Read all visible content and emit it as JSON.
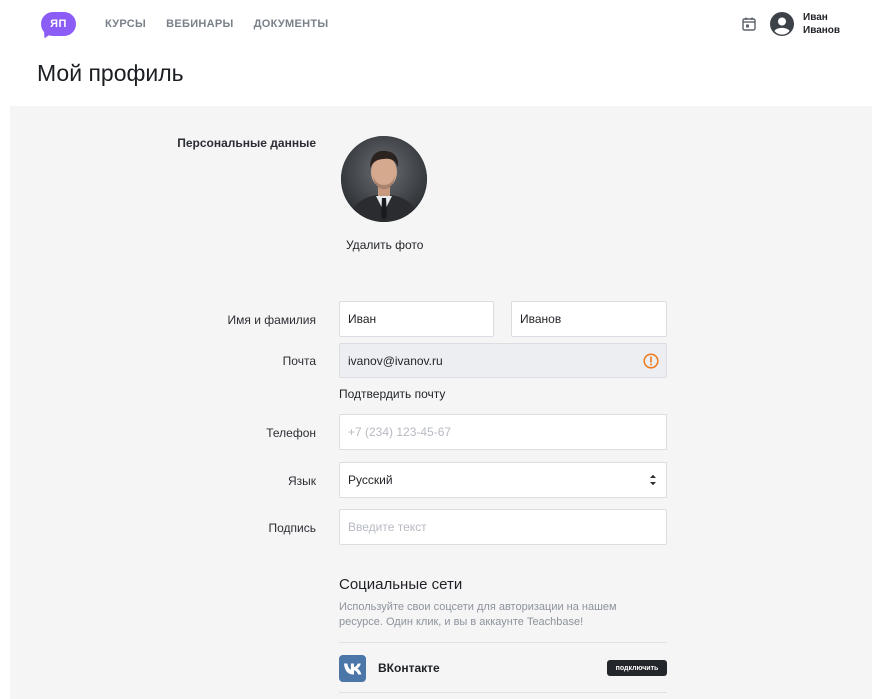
{
  "header": {
    "logo_text": "ЯП",
    "nav": [
      "КУРСЫ",
      "ВЕБИНАРЫ",
      "ДОКУМЕНТЫ"
    ],
    "user": {
      "first_name": "Иван",
      "last_name": "Иванов"
    },
    "icons": [
      "calendar-icon",
      "user-avatar-icon"
    ],
    "accent_color": "#8b5cf6"
  },
  "page": {
    "title": "Мой профиль"
  },
  "personal": {
    "section_label": "Персональные данные",
    "delete_photo": "Удалить фото"
  },
  "form": {
    "name_label": "Имя и фамилия",
    "first_name": "Иван",
    "last_name": "Иванов",
    "email_label": "Почта",
    "email_value": "ivanov@ivanov.ru",
    "confirm_email": "Подтвердить почту",
    "phone_label": "Телефон",
    "phone_placeholder": "+7 (234) 123-45-67",
    "language_label": "Язык",
    "language_value": "Русский",
    "signature_label": "Подпись",
    "signature_placeholder": "Введите текст",
    "warning_color": "#f07a1a"
  },
  "social": {
    "title": "Социальные сети",
    "description": "Используйте свои соцсети для авторизации на нашем ресурсе. Один клик, и вы в аккаунте Teachbase!",
    "items": [
      {
        "icon": "vk-icon",
        "name": "ВКонтакте",
        "button": "подключить",
        "color": "#4a76a8"
      }
    ]
  }
}
